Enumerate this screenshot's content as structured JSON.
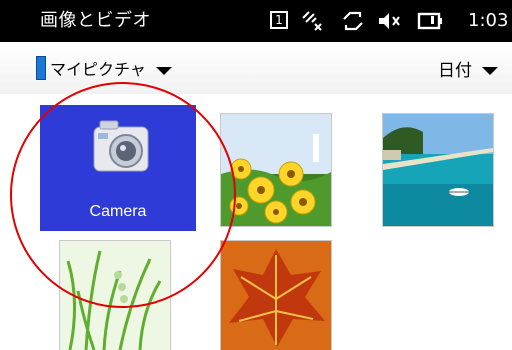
{
  "title_bar": {
    "app_title": "画像とビデオ",
    "status": {
      "box_label": "1",
      "clock": "1:03"
    }
  },
  "menu_bar": {
    "folder_label": "マイピクチャ",
    "sort_label": "日付"
  },
  "grid": {
    "camera_label": "Camera",
    "thumbnails": [
      "yellow-flowers",
      "beach-pier",
      "green-grass",
      "red-leaf"
    ]
  },
  "colors": {
    "selection_blue": "#2f3bd6",
    "annotation_red": "#e30000"
  }
}
